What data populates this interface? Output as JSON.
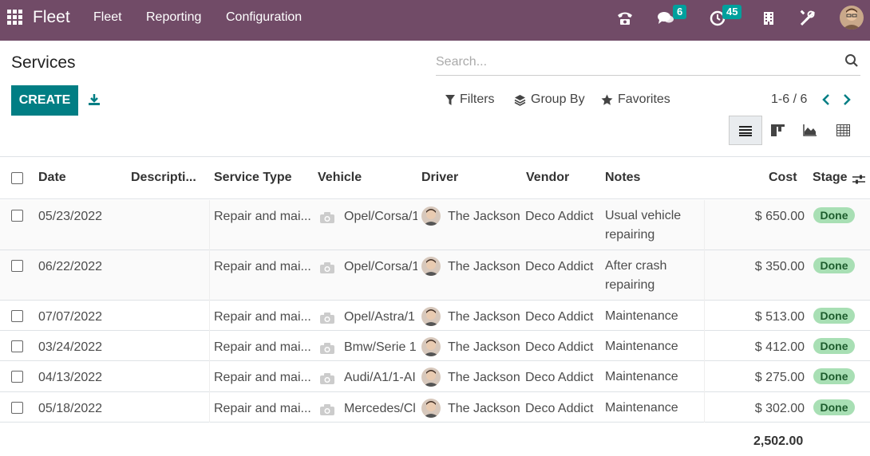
{
  "navbar": {
    "brand": "Fleet",
    "menu": [
      "Fleet",
      "Reporting",
      "Configuration"
    ],
    "messages_count": "6",
    "activities_count": "45",
    "colors": {
      "bg": "#714b67",
      "badge": "#00a09d"
    }
  },
  "control_panel": {
    "title": "Services",
    "search_placeholder": "Search...",
    "create_label": "CREATE",
    "filters_label": "Filters",
    "groupby_label": "Group By",
    "favorites_label": "Favorites",
    "pager": "1-6 / 6"
  },
  "table": {
    "headers": {
      "date": "Date",
      "description": "Descripti...",
      "service_type": "Service Type",
      "vehicle": "Vehicle",
      "driver": "Driver",
      "vendor": "Vendor",
      "notes": "Notes",
      "cost": "Cost",
      "stage": "Stage"
    },
    "rows": [
      {
        "date": "05/23/2022",
        "service_type": "Repair and mai...",
        "vehicle": "Opel/Corsa/1",
        "driver": "The Jackson",
        "vendor": "Deco Addict",
        "notes": "Usual vehicle repairing",
        "cost": "$ 650.00",
        "stage": "Done"
      },
      {
        "date": "06/22/2022",
        "service_type": "Repair and mai...",
        "vehicle": "Opel/Corsa/1",
        "driver": "The Jackson",
        "vendor": "Deco Addict",
        "notes": "After crash repairing",
        "cost": "$ 350.00",
        "stage": "Done"
      },
      {
        "date": "07/07/2022",
        "service_type": "Repair and mai...",
        "vehicle": "Opel/Astra/1",
        "driver": "The Jackson",
        "vendor": "Deco Addict",
        "notes": "Maintenance",
        "cost": "$ 513.00",
        "stage": "Done"
      },
      {
        "date": "03/24/2022",
        "service_type": "Repair and mai...",
        "vehicle": "Bmw/Serie 1",
        "driver": "The Jackson",
        "vendor": "Deco Addict",
        "notes": "Maintenance",
        "cost": "$ 412.00",
        "stage": "Done"
      },
      {
        "date": "04/13/2022",
        "service_type": "Repair and mai...",
        "vehicle": "Audi/A1/1-AI",
        "driver": "The Jackson",
        "vendor": "Deco Addict",
        "notes": "Maintenance",
        "cost": "$ 275.00",
        "stage": "Done"
      },
      {
        "date": "05/18/2022",
        "service_type": "Repair and mai...",
        "vehicle": "Mercedes/Cl",
        "driver": "The Jackson",
        "vendor": "Deco Addict",
        "notes": "Maintenance",
        "cost": "$ 302.00",
        "stage": "Done"
      }
    ],
    "total": "2,502.00"
  }
}
